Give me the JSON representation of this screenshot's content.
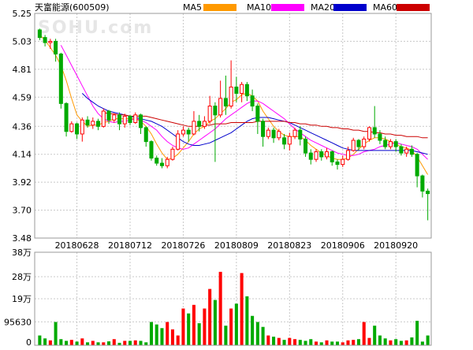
{
  "header": {
    "title": "天富能源(600509)",
    "watermark": "SOHU.com"
  },
  "legend": [
    {
      "label": "MA5",
      "color": "#ff9900"
    },
    {
      "label": "MA10",
      "color": "#ff00ff"
    },
    {
      "label": "MA20",
      "color": "#0000cc"
    },
    {
      "label": "MA60",
      "color": "#cc0000"
    }
  ],
  "chart_data": [
    {
      "type": "candlestick",
      "title": "天富能源(600509)",
      "y_ticks": [
        "5.25",
        "5.03",
        "4.81",
        "4.59",
        "4.36",
        "4.14",
        "3.92",
        "3.70",
        "3.48"
      ],
      "ylim": [
        3.48,
        5.25
      ],
      "x_ticks": [
        {
          "label": "20180628",
          "index": 7
        },
        {
          "label": "20180712",
          "index": 17
        },
        {
          "label": "20180726",
          "index": 27
        },
        {
          "label": "20180809",
          "index": 37
        },
        {
          "label": "20180823",
          "index": 47
        },
        {
          "label": "20180906",
          "index": 57
        },
        {
          "label": "20180920",
          "index": 67
        }
      ],
      "colors": {
        "up": "#ff0000",
        "down": "#00aa00"
      },
      "candles": [
        [
          5.12,
          5.06,
          5.13,
          5.04
        ],
        [
          5.06,
          5.02,
          5.08,
          4.99
        ],
        [
          5.02,
          5.03,
          5.05,
          4.97
        ],
        [
          5.03,
          4.93,
          5.05,
          4.87
        ],
        [
          4.93,
          4.54,
          4.94,
          4.5
        ],
        [
          4.54,
          4.32,
          4.55,
          4.28
        ],
        [
          4.32,
          4.38,
          4.4,
          4.31
        ],
        [
          4.38,
          4.3,
          4.39,
          4.26
        ],
        [
          4.3,
          4.41,
          4.43,
          4.24
        ],
        [
          4.41,
          4.37,
          4.44,
          4.35
        ],
        [
          4.37,
          4.4,
          4.43,
          4.34
        ],
        [
          4.4,
          4.36,
          4.42,
          4.33
        ],
        [
          4.36,
          4.48,
          4.5,
          4.35
        ],
        [
          4.48,
          4.41,
          4.49,
          4.38
        ],
        [
          4.41,
          4.45,
          4.46,
          4.39
        ],
        [
          4.45,
          4.38,
          4.47,
          4.33
        ],
        [
          4.38,
          4.44,
          4.46,
          4.35
        ],
        [
          4.44,
          4.39,
          4.45,
          4.37
        ],
        [
          4.39,
          4.45,
          4.47,
          4.38
        ],
        [
          4.45,
          4.35,
          4.46,
          4.3
        ],
        [
          4.35,
          4.24,
          4.36,
          4.2
        ],
        [
          4.24,
          4.11,
          4.25,
          4.09
        ],
        [
          4.11,
          4.07,
          4.13,
          4.05
        ],
        [
          4.07,
          4.05,
          4.11,
          4.03
        ],
        [
          4.05,
          4.1,
          4.12,
          4.03
        ],
        [
          4.1,
          4.18,
          4.2,
          4.09
        ],
        [
          4.18,
          4.3,
          4.33,
          4.17
        ],
        [
          4.3,
          4.33,
          4.36,
          4.28
        ],
        [
          4.33,
          4.3,
          4.35,
          4.24
        ],
        [
          4.3,
          4.4,
          4.48,
          4.29
        ],
        [
          4.4,
          4.36,
          4.45,
          4.32
        ],
        [
          4.36,
          4.4,
          4.44,
          4.34
        ],
        [
          4.4,
          4.52,
          4.6,
          4.38
        ],
        [
          4.52,
          4.45,
          4.55,
          4.08
        ],
        [
          4.45,
          4.58,
          4.72,
          4.43
        ],
        [
          4.58,
          4.52,
          4.76,
          4.45
        ],
        [
          4.52,
          4.67,
          4.88,
          4.5
        ],
        [
          4.67,
          4.62,
          4.75,
          4.55
        ],
        [
          4.62,
          4.69,
          4.71,
          4.55
        ],
        [
          4.69,
          4.6,
          4.71,
          4.56
        ],
        [
          4.6,
          4.52,
          4.65,
          4.48
        ],
        [
          4.52,
          4.4,
          4.54,
          4.3
        ],
        [
          4.4,
          4.28,
          4.42,
          4.2
        ],
        [
          4.28,
          4.33,
          4.35,
          4.26
        ],
        [
          4.33,
          4.27,
          4.35,
          4.23
        ],
        [
          4.27,
          4.32,
          4.34,
          4.25
        ],
        [
          4.27,
          4.22,
          4.3,
          4.18
        ],
        [
          4.22,
          4.28,
          4.31,
          4.17
        ],
        [
          4.28,
          4.33,
          4.35,
          4.26
        ],
        [
          4.33,
          4.26,
          4.36,
          4.21
        ],
        [
          4.26,
          4.15,
          4.28,
          4.12
        ],
        [
          4.15,
          4.1,
          4.18,
          4.06
        ],
        [
          4.1,
          4.16,
          4.18,
          4.08
        ],
        [
          4.16,
          4.12,
          4.18,
          4.09
        ],
        [
          4.12,
          4.16,
          4.19,
          4.1
        ],
        [
          4.16,
          4.08,
          4.17,
          4.05
        ],
        [
          4.08,
          4.06,
          4.1,
          4.02
        ],
        [
          4.06,
          4.1,
          4.13,
          4.04
        ],
        [
          4.1,
          4.17,
          4.2,
          4.09
        ],
        [
          4.17,
          4.25,
          4.27,
          4.16
        ],
        [
          4.25,
          4.2,
          4.26,
          4.17
        ],
        [
          4.2,
          4.26,
          4.28,
          4.18
        ],
        [
          4.26,
          4.35,
          4.36,
          4.24
        ],
        [
          4.35,
          4.3,
          4.52,
          4.27
        ],
        [
          4.3,
          4.25,
          4.33,
          4.22
        ],
        [
          4.25,
          4.2,
          4.28,
          4.18
        ],
        [
          4.2,
          4.24,
          4.26,
          4.18
        ],
        [
          4.24,
          4.2,
          4.26,
          4.16
        ],
        [
          4.2,
          4.15,
          4.22,
          4.13
        ],
        [
          4.15,
          4.18,
          4.2,
          4.12
        ],
        [
          4.18,
          4.14,
          4.21,
          4.12
        ],
        [
          4.14,
          3.97,
          4.15,
          3.88
        ],
        [
          3.97,
          3.85,
          3.98,
          3.8
        ],
        [
          3.85,
          3.83,
          3.87,
          3.62
        ]
      ],
      "ma": {
        "ma5": [
          5.08,
          5.04,
          4.98,
          4.92,
          4.84,
          4.72,
          4.58,
          4.45,
          4.4,
          4.36,
          4.37,
          4.37,
          4.39,
          4.4,
          4.42,
          4.42,
          4.42,
          4.42,
          4.42,
          4.4,
          4.36,
          4.3,
          4.22,
          4.15,
          4.1,
          4.11,
          4.14,
          4.19,
          4.24,
          4.3,
          4.34,
          4.36,
          4.4,
          4.42,
          4.46,
          4.5,
          4.55,
          4.57,
          4.61,
          4.62,
          4.6,
          4.56,
          4.48,
          4.42,
          4.36,
          4.32,
          4.29,
          4.28,
          4.28,
          4.28,
          4.25,
          4.21,
          4.18,
          4.15,
          4.13,
          4.11,
          4.1,
          4.1,
          4.11,
          4.14,
          4.18,
          4.22,
          4.25,
          4.27,
          4.27,
          4.26,
          4.24,
          4.22,
          4.2,
          4.19,
          4.17,
          4.12,
          4.05,
          3.98
        ],
        "ma10": [
          null,
          null,
          null,
          null,
          5.0,
          4.92,
          4.84,
          4.76,
          4.68,
          4.6,
          4.52,
          4.46,
          4.42,
          4.4,
          4.39,
          4.4,
          4.4,
          4.41,
          4.42,
          4.41,
          4.39,
          4.36,
          4.33,
          4.28,
          4.24,
          4.21,
          4.19,
          4.18,
          4.19,
          4.22,
          4.25,
          4.28,
          4.31,
          4.34,
          4.38,
          4.42,
          4.45,
          4.48,
          4.51,
          4.54,
          4.56,
          4.56,
          4.54,
          4.51,
          4.48,
          4.45,
          4.42,
          4.38,
          4.34,
          4.31,
          4.28,
          4.25,
          4.23,
          4.21,
          4.19,
          4.17,
          4.15,
          4.14,
          4.13,
          4.13,
          4.14,
          4.16,
          4.17,
          4.18,
          4.2,
          4.21,
          4.22,
          4.23,
          4.22,
          4.21,
          4.2,
          4.18,
          4.14,
          4.1
        ],
        "ma20": [
          null,
          null,
          null,
          null,
          null,
          null,
          null,
          null,
          4.62,
          4.58,
          4.55,
          4.52,
          4.5,
          4.48,
          4.47,
          4.46,
          4.45,
          4.44,
          4.43,
          4.42,
          4.41,
          4.4,
          4.38,
          4.36,
          4.33,
          4.3,
          4.27,
          4.24,
          4.22,
          4.21,
          4.21,
          4.22,
          4.23,
          4.25,
          4.27,
          4.29,
          4.31,
          4.34,
          4.37,
          4.4,
          4.42,
          4.43,
          4.43,
          4.43,
          4.42,
          4.41,
          4.4,
          4.39,
          4.37,
          4.35,
          4.33,
          4.31,
          4.29,
          4.27,
          4.25,
          4.23,
          4.21,
          4.19,
          4.18,
          4.17,
          4.17,
          4.17,
          4.17,
          4.17,
          4.17,
          4.17,
          4.17,
          4.17,
          4.17,
          4.17,
          4.17,
          4.16,
          4.15,
          4.14
        ],
        "ma60": [
          null,
          null,
          null,
          null,
          null,
          null,
          null,
          null,
          null,
          null,
          null,
          null,
          4.47,
          4.46,
          4.46,
          4.45,
          4.45,
          4.44,
          4.44,
          4.44,
          4.44,
          4.43,
          4.42,
          4.41,
          4.4,
          4.39,
          4.38,
          4.37,
          4.36,
          4.36,
          4.36,
          4.37,
          4.37,
          4.38,
          4.38,
          4.38,
          4.39,
          4.39,
          4.39,
          4.39,
          4.39,
          4.4,
          4.4,
          4.4,
          4.4,
          4.4,
          4.4,
          4.39,
          4.39,
          4.38,
          4.38,
          4.37,
          4.37,
          4.36,
          4.36,
          4.35,
          4.35,
          4.34,
          4.34,
          4.33,
          4.33,
          4.32,
          4.32,
          4.31,
          4.31,
          4.3,
          4.3,
          4.29,
          4.29,
          4.28,
          4.28,
          4.28,
          4.27,
          4.27
        ]
      }
    },
    {
      "type": "bar",
      "title": "",
      "y_ticks": [
        "38万",
        "28万",
        "19万",
        "95630",
        "0"
      ],
      "ylim": [
        0,
        380000
      ],
      "values": [
        40000,
        28000,
        20000,
        95000,
        25000,
        18000,
        22000,
        15000,
        28000,
        12000,
        18000,
        12000,
        12000,
        16000,
        25000,
        10000,
        18000,
        18000,
        20000,
        18000,
        12000,
        95000,
        85000,
        70000,
        95000,
        65000,
        40000,
        150000,
        130000,
        165000,
        90000,
        150000,
        230000,
        185000,
        300000,
        80000,
        150000,
        170000,
        295000,
        200000,
        120000,
        95000,
        75000,
        40000,
        35000,
        30000,
        22000,
        30000,
        25000,
        22000,
        18000,
        25000,
        15000,
        12000,
        20000,
        15000,
        15000,
        12000,
        20000,
        22000,
        25000,
        95000,
        30000,
        80000,
        40000,
        28000,
        20000,
        25000,
        18000,
        20000,
        32000,
        100000,
        15000,
        40000
      ]
    }
  ]
}
